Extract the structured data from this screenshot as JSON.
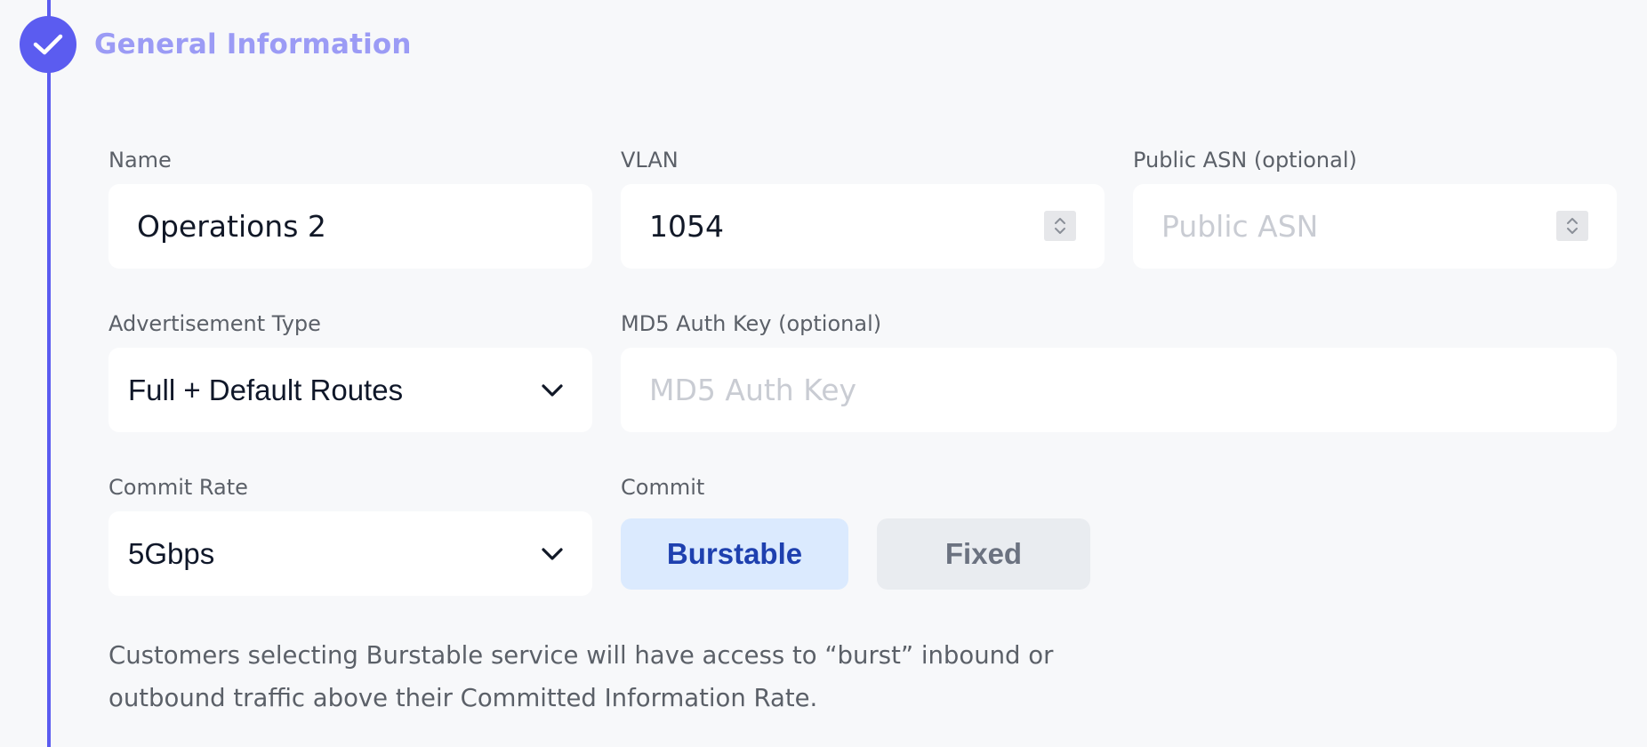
{
  "step": {
    "title": "General Information",
    "status_icon": "check-icon",
    "accent_color": "#5b5cf0",
    "title_color": "#9b9bf5"
  },
  "form": {
    "name": {
      "label": "Name",
      "value": "Operations 2"
    },
    "vlan": {
      "label": "VLAN",
      "value": "1054"
    },
    "public_asn": {
      "label": "Public ASN (optional)",
      "placeholder": "Public ASN"
    },
    "advertisement_type": {
      "label": "Advertisement Type",
      "selected": "Full + Default Routes"
    },
    "md5_auth_key": {
      "label": "MD5 Auth Key (optional)",
      "placeholder": "MD5 Auth Key"
    },
    "commit_rate": {
      "label": "Commit Rate",
      "selected": "5Gbps"
    },
    "commit": {
      "label": "Commit",
      "options": [
        "Burstable",
        "Fixed"
      ],
      "selected": "Burstable"
    },
    "help_text": "Customers selecting Burstable service will have access to “burst” inbound or outbound traffic above their Committed Information Rate."
  },
  "colors": {
    "page_background": "#f7f8fa",
    "active_button_bg": "#dbeafe",
    "active_button_text": "#1e40af",
    "inactive_button_bg": "#e9ecf0",
    "inactive_button_text": "#6b7280"
  }
}
